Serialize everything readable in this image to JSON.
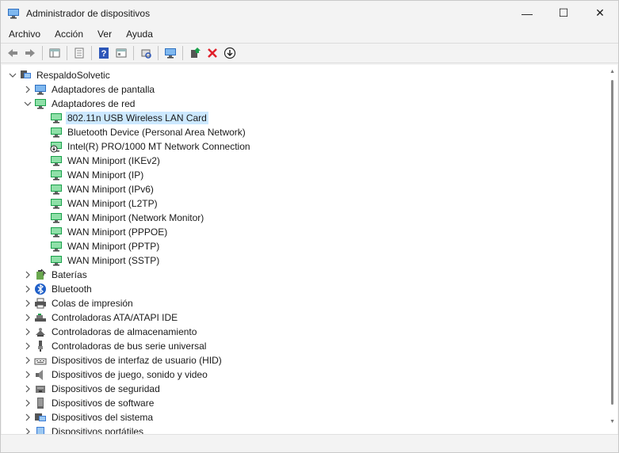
{
  "window": {
    "title": "Administrador de dispositivos",
    "controls": {
      "minimize": "—",
      "maximize": "☐",
      "close": "✕"
    }
  },
  "menu": [
    "Archivo",
    "Acción",
    "Ver",
    "Ayuda"
  ],
  "toolbar": {
    "buttons": [
      "back-icon",
      "forward-icon",
      "properties-pane-icon",
      "properties-icon",
      "help-icon",
      "view-icon",
      "scan-icon",
      "monitor-icon",
      "update-driver-icon",
      "uninstall-icon",
      "disable-icon"
    ]
  },
  "tree": {
    "root": "RespaldoSolvetic",
    "items": [
      {
        "label": "Adaptadores de pantalla",
        "icon": "display-icon",
        "expanded": false,
        "level": 1
      },
      {
        "label": "Adaptadores de red",
        "icon": "network-icon",
        "expanded": true,
        "level": 1
      },
      {
        "label": "802.11n USB Wireless LAN Card",
        "icon": "network-icon",
        "level": 2,
        "selected": true
      },
      {
        "label": "Bluetooth Device (Personal Area Network)",
        "icon": "network-icon",
        "level": 2
      },
      {
        "label": "Intel(R) PRO/1000 MT Network Connection",
        "icon": "network-disabled-icon",
        "level": 2
      },
      {
        "label": "WAN Miniport (IKEv2)",
        "icon": "network-icon",
        "level": 2
      },
      {
        "label": "WAN Miniport (IP)",
        "icon": "network-icon",
        "level": 2
      },
      {
        "label": "WAN Miniport (IPv6)",
        "icon": "network-icon",
        "level": 2
      },
      {
        "label": "WAN Miniport (L2TP)",
        "icon": "network-icon",
        "level": 2
      },
      {
        "label": "WAN Miniport (Network Monitor)",
        "icon": "network-icon",
        "level": 2
      },
      {
        "label": "WAN Miniport (PPPOE)",
        "icon": "network-icon",
        "level": 2
      },
      {
        "label": "WAN Miniport (PPTP)",
        "icon": "network-icon",
        "level": 2
      },
      {
        "label": "WAN Miniport (SSTP)",
        "icon": "network-icon",
        "level": 2
      },
      {
        "label": "Baterías",
        "icon": "battery-icon",
        "expanded": false,
        "level": 1
      },
      {
        "label": "Bluetooth",
        "icon": "bluetooth-icon",
        "expanded": false,
        "level": 1
      },
      {
        "label": "Colas de impresión",
        "icon": "printer-icon",
        "expanded": false,
        "level": 1
      },
      {
        "label": "Controladoras ATA/ATAPI IDE",
        "icon": "ide-controller-icon",
        "expanded": false,
        "level": 1
      },
      {
        "label": "Controladoras de almacenamiento",
        "icon": "storage-controller-icon",
        "expanded": false,
        "level": 1
      },
      {
        "label": "Controladoras de bus serie universal",
        "icon": "usb-icon",
        "expanded": false,
        "level": 1
      },
      {
        "label": "Dispositivos de interfaz de usuario (HID)",
        "icon": "keyboard-icon",
        "expanded": false,
        "level": 1
      },
      {
        "label": "Dispositivos de juego, sonido y video",
        "icon": "speaker-icon",
        "expanded": false,
        "level": 1
      },
      {
        "label": "Dispositivos de seguridad",
        "icon": "security-icon",
        "expanded": false,
        "level": 1
      },
      {
        "label": "Dispositivos de software",
        "icon": "software-device-icon",
        "expanded": false,
        "level": 1
      },
      {
        "label": "Dispositivos del sistema",
        "icon": "system-device-icon",
        "expanded": false,
        "level": 1
      },
      {
        "label": "Dispositivos portátiles",
        "icon": "portable-device-icon",
        "expanded": false,
        "level": 1
      }
    ]
  },
  "colors": {
    "accent": "#0078d4",
    "selection": "#cce8ff",
    "network_green": "#19a04a"
  }
}
